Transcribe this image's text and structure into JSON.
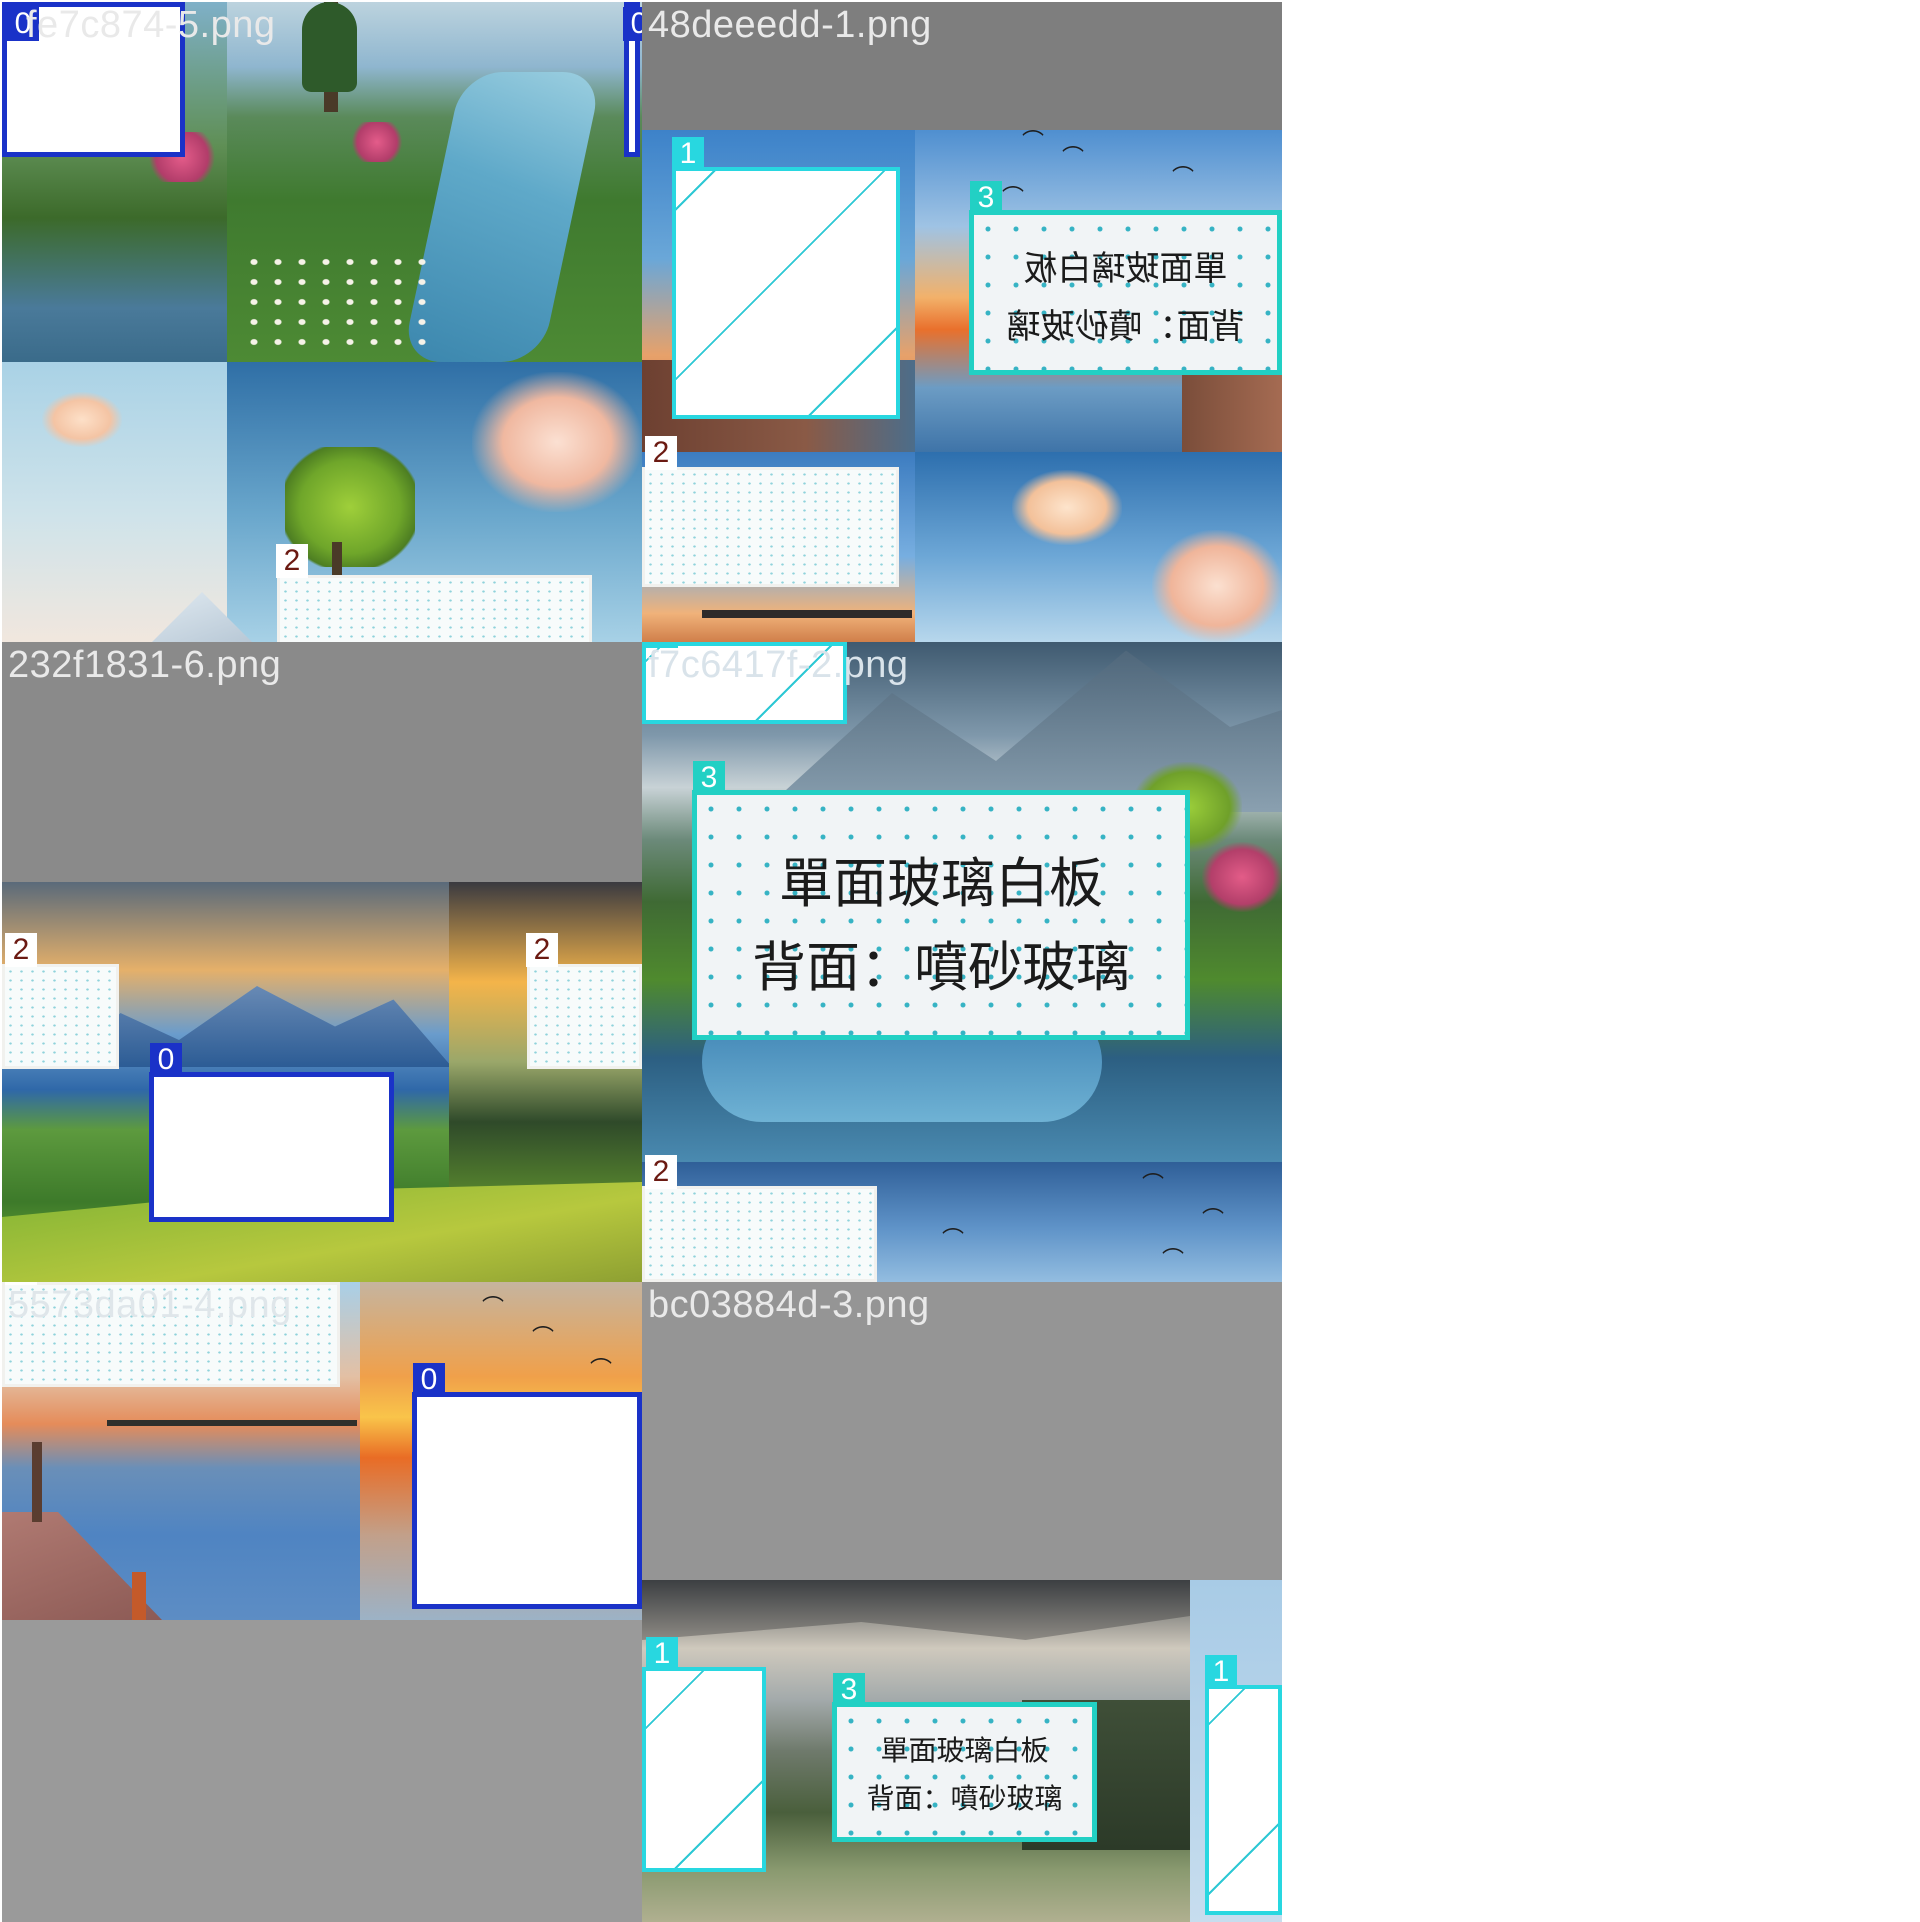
{
  "tiles": [
    {
      "label": "fe7c874-5.png"
    },
    {
      "label": "48deeedd-1.png"
    },
    {
      "label": "232f1831-6.png"
    },
    {
      "label": "f7c6417f-2.png"
    },
    {
      "label": "5573da01-4.png"
    },
    {
      "label": "bc03884d-3.png"
    }
  ],
  "classes": {
    "c0": "0",
    "c1": "1",
    "c2": "2",
    "c3": "3"
  },
  "sign": {
    "line1": "單面玻璃白板",
    "line2": "背面：噴砂玻璃",
    "line1_mirrored": "單面玻璃白板",
    "line2_mirrored": "背面：噴砂玻璃"
  },
  "colors": {
    "class0": "#1a32c8",
    "class1": "#28d7e0",
    "class2": "#f1f1ee",
    "class3": "#22d0c4",
    "tile_padding": "#8c8c8c"
  }
}
